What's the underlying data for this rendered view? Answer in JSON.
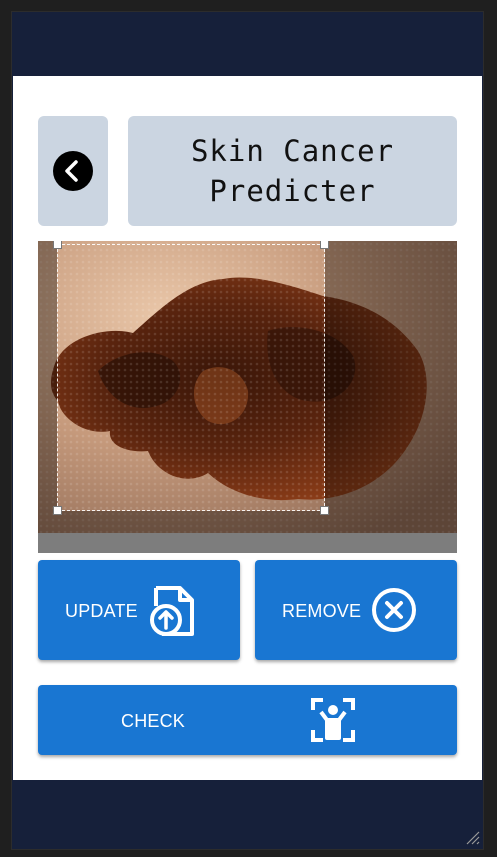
{
  "header": {
    "title": "Skin Cancer\nPredicter",
    "back_icon": "chevron-left-icon"
  },
  "image_panel": {
    "subject": "skin lesion photo",
    "crop_enabled": true
  },
  "actions": {
    "update_label": "UPDATE",
    "update_icon": "file-upload-icon",
    "remove_label": "REMOVE",
    "remove_icon": "close-circle-icon",
    "check_label": "CHECK",
    "check_icon": "person-scan-icon"
  },
  "colors": {
    "accent": "#1976d2",
    "header_card": "#cbd5e1",
    "app_bar": "#16203a"
  }
}
